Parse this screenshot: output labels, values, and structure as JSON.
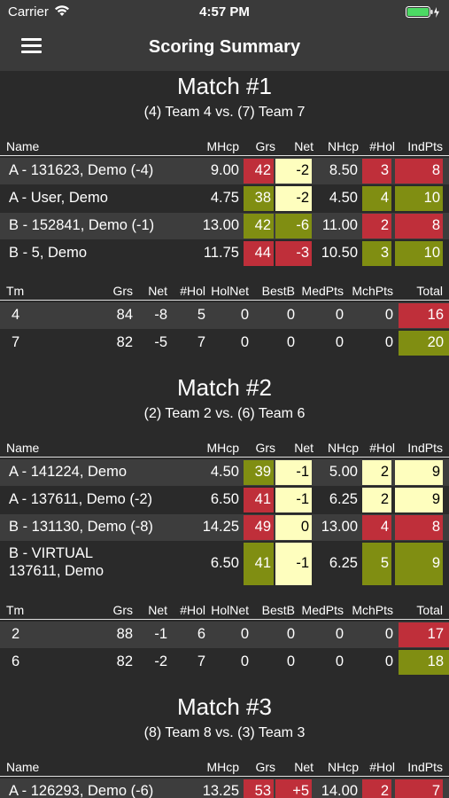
{
  "status_bar": {
    "carrier": "Carrier",
    "time": "4:57 PM"
  },
  "nav": {
    "title": "Scoring Summary"
  },
  "player_headers": [
    "Name",
    "MHcp",
    "Grs",
    "Net",
    "NHcp",
    "#Hol",
    "IndPts"
  ],
  "team_headers": [
    "Tm",
    "Grs",
    "Net",
    "#Hol",
    "HolNet",
    "BestB",
    "MedPts",
    "MchPts",
    "Total"
  ],
  "colors": {
    "red": "#bf2f3a",
    "green": "#808e12",
    "yellow": "#fefebe"
  },
  "matches": [
    {
      "title": "Match #1",
      "subtitle": "(4) Team 4 vs. (7) Team 7",
      "players": [
        {
          "name": "A - 131623, Demo (-4)",
          "name2": "",
          "mhcp": "9.00",
          "grs": "42",
          "grs_c": "red",
          "net": "-2",
          "net_c": "yellow",
          "nhcp": "8.50",
          "hol": "3",
          "hol_c": "red",
          "ind": "8",
          "ind_c": "red"
        },
        {
          "name": "A - User, Demo",
          "name2": "",
          "mhcp": "4.75",
          "grs": "38",
          "grs_c": "green",
          "net": "-2",
          "net_c": "yellow",
          "nhcp": "4.50",
          "hol": "4",
          "hol_c": "green",
          "ind": "10",
          "ind_c": "green"
        },
        {
          "name": "B - 152841, Demo (-1)",
          "name2": "",
          "mhcp": "13.00",
          "grs": "42",
          "grs_c": "green",
          "net": "-6",
          "net_c": "green",
          "nhcp": "11.00",
          "hol": "2",
          "hol_c": "red",
          "ind": "8",
          "ind_c": "red"
        },
        {
          "name": "B - 5, Demo",
          "name2": "",
          "mhcp": "11.75",
          "grs": "44",
          "grs_c": "red",
          "net": "-3",
          "net_c": "red",
          "nhcp": "10.50",
          "hol": "3",
          "hol_c": "green",
          "ind": "10",
          "ind_c": "green"
        }
      ],
      "teams": [
        {
          "tm": "4",
          "grs": "84",
          "net": "-8",
          "hol": "5",
          "holnet": "0",
          "bestb": "0",
          "medpts": "0",
          "mchpts": "0",
          "total": "16",
          "total_c": "red"
        },
        {
          "tm": "7",
          "grs": "82",
          "net": "-5",
          "hol": "7",
          "holnet": "0",
          "bestb": "0",
          "medpts": "0",
          "mchpts": "0",
          "total": "20",
          "total_c": "green"
        }
      ]
    },
    {
      "title": "Match #2",
      "subtitle": "(2) Team 2 vs. (6) Team 6",
      "players": [
        {
          "name": "A - 141224, Demo",
          "name2": "",
          "mhcp": "4.50",
          "grs": "39",
          "grs_c": "green",
          "net": "-1",
          "net_c": "yellow",
          "nhcp": "5.00",
          "hol": "2",
          "hol_c": "yellow",
          "ind": "9",
          "ind_c": "yellow"
        },
        {
          "name": "A - 137611, Demo (-2)",
          "name2": "",
          "mhcp": "6.50",
          "grs": "41",
          "grs_c": "red",
          "net": "-1",
          "net_c": "yellow",
          "nhcp": "6.25",
          "hol": "2",
          "hol_c": "yellow",
          "ind": "9",
          "ind_c": "yellow"
        },
        {
          "name": "B - 131130, Demo (-8)",
          "name2": "",
          "mhcp": "14.25",
          "grs": "49",
          "grs_c": "red",
          "net": "0",
          "net_c": "yellow",
          "nhcp": "13.00",
          "hol": "4",
          "hol_c": "red",
          "ind": "8",
          "ind_c": "red"
        },
        {
          "name": "B - VIRTUAL",
          "name2": "137611, Demo",
          "mhcp": "6.50",
          "grs": "41",
          "grs_c": "green",
          "net": "-1",
          "net_c": "yellow",
          "nhcp": "6.25",
          "hol": "5",
          "hol_c": "green",
          "ind": "9",
          "ind_c": "green"
        }
      ],
      "teams": [
        {
          "tm": "2",
          "grs": "88",
          "net": "-1",
          "hol": "6",
          "holnet": "0",
          "bestb": "0",
          "medpts": "0",
          "mchpts": "0",
          "total": "17",
          "total_c": "red"
        },
        {
          "tm": "6",
          "grs": "82",
          "net": "-2",
          "hol": "7",
          "holnet": "0",
          "bestb": "0",
          "medpts": "0",
          "mchpts": "0",
          "total": "18",
          "total_c": "green"
        }
      ]
    },
    {
      "title": "Match #3",
      "subtitle": "(8) Team 8 vs. (3) Team 3",
      "players": [
        {
          "name": "A - 126293, Demo (-6)",
          "name2": "",
          "mhcp": "13.25",
          "grs": "53",
          "grs_c": "red",
          "net": "+5",
          "net_c": "red",
          "nhcp": "14.00",
          "hol": "2",
          "hol_c": "red",
          "ind": "7",
          "ind_c": "red"
        }
      ],
      "teams": []
    }
  ]
}
